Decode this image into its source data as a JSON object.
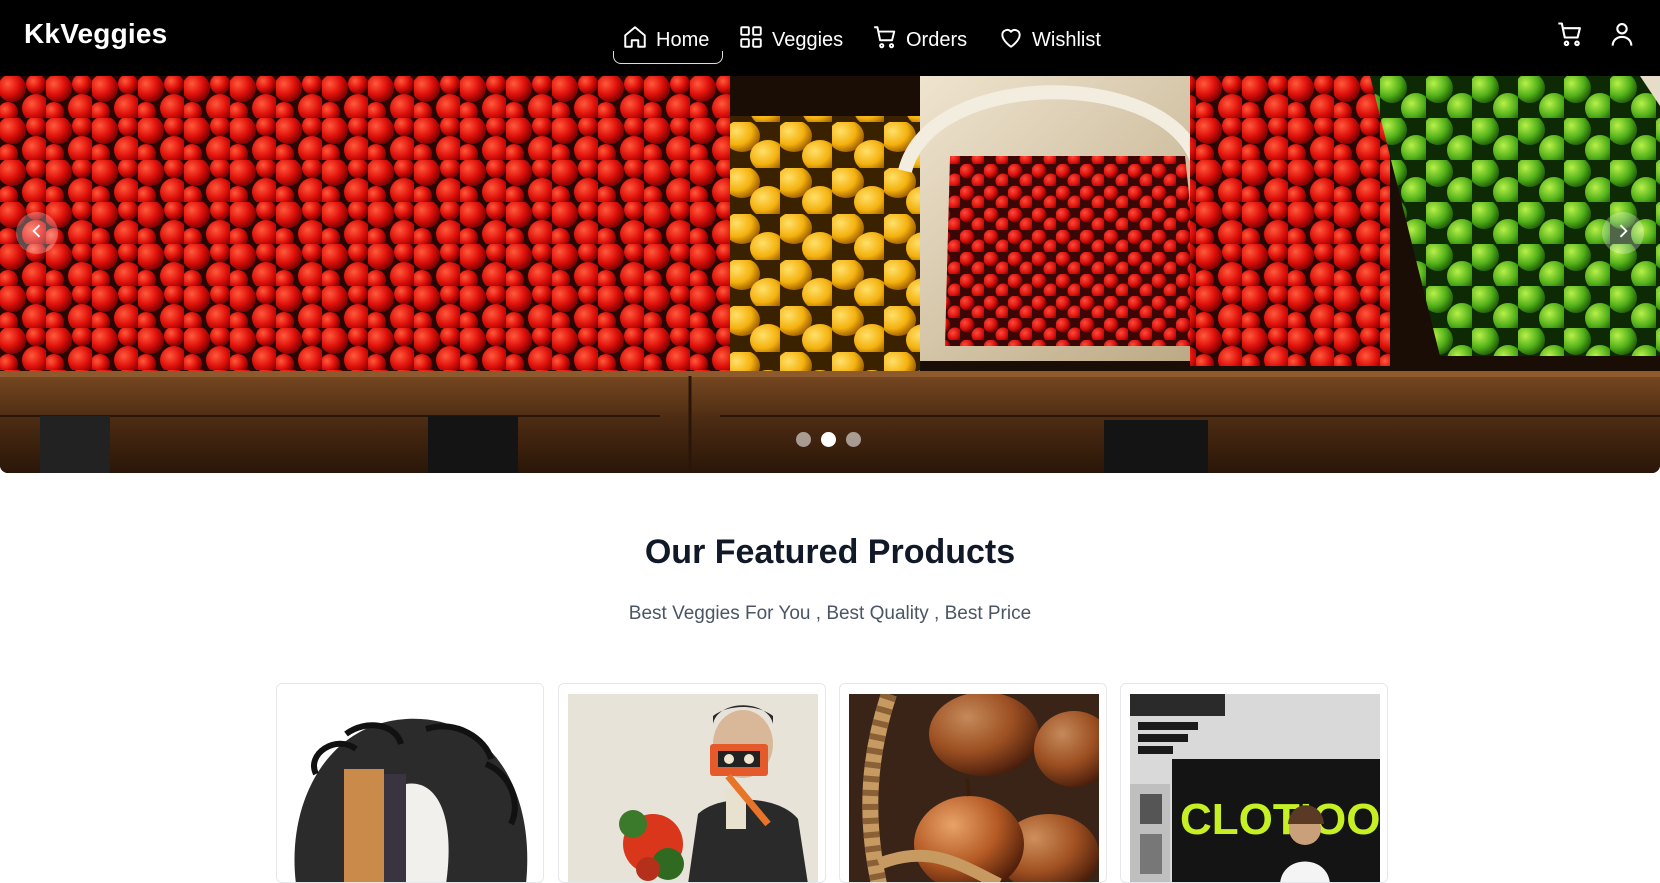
{
  "brand": "KkVeggies",
  "nav": {
    "home": "Home",
    "veggies": "Veggies",
    "orders": "Orders",
    "wishlist": "Wishlist",
    "active": "Home"
  },
  "header_icons": [
    "cart-icon",
    "user-icon"
  ],
  "carousel": {
    "slide_count": 3,
    "active_slide": 2
  },
  "featured": {
    "title": "Our Featured Products",
    "subtitle": "Best Veggies For You , Best Quality , Best Price"
  },
  "products": [
    {
      "image": "product-image-1"
    },
    {
      "image": "product-image-2"
    },
    {
      "image": "product-image-3"
    },
    {
      "image": "product-image-4",
      "image_text": "CLOTIOO"
    }
  ],
  "colors": {
    "navbar_bg": "#000000",
    "text_dark": "#111827",
    "text_muted": "#4b5563"
  }
}
